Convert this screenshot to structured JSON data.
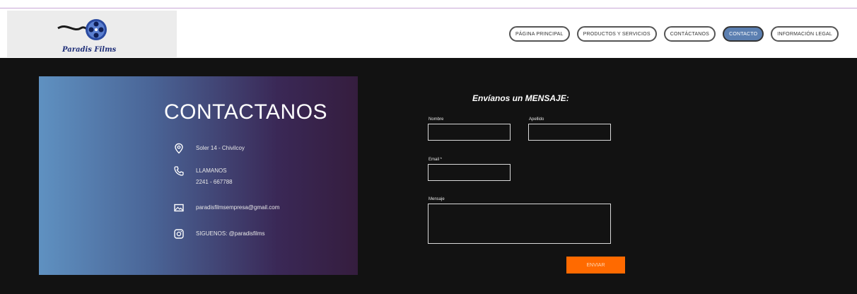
{
  "brand": {
    "logo_text": "Paradis Films"
  },
  "nav": {
    "items": [
      {
        "label": "PÁGINA PRINCIPAL",
        "active": false
      },
      {
        "label": "PRODUCTOS Y SERVICIOS",
        "active": false
      },
      {
        "label": "CONTÁCTANOS",
        "active": false
      },
      {
        "label": "CONTACTO",
        "active": true
      },
      {
        "label": "INFORMACIÓN LEGAL",
        "active": false
      }
    ]
  },
  "contact_card": {
    "title": "CONTACTANOS",
    "address": "Soler 14 - Chivilcoy",
    "phone_label": "LLAMANOS",
    "phone": "2241 - 667788",
    "email": "paradisfilmsempresa@gmail.com",
    "social": "SIGUENOS: @paradisfilms"
  },
  "form": {
    "title": "Envíanos un MENSAJE:",
    "name_label": "Nombre",
    "lastname_label": "Apellido",
    "email_label": "Email *",
    "message_label": "Mensaje",
    "submit_label": "ENVIAR"
  },
  "colors": {
    "accent": "#ff6a00",
    "nav_active": "#5b7fb1",
    "background": "#121212"
  }
}
